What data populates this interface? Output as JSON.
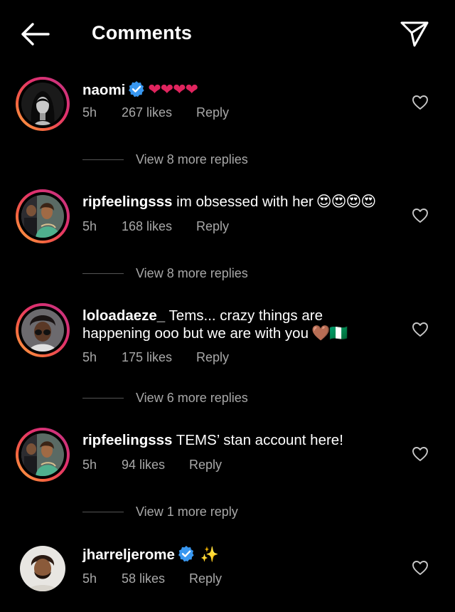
{
  "header": {
    "title": "Comments",
    "back_icon": "arrow-left-icon",
    "share_icon": "paper-plane-icon"
  },
  "colors": {
    "background": "#000000",
    "text": "#ffffff",
    "secondary": "#a8a8a8",
    "heart": "#e0245e",
    "verified": "#3897f0"
  },
  "comments": [
    {
      "username": "naomi",
      "verified": true,
      "text": "",
      "emoji": "❤❤❤❤",
      "time": "5h",
      "likes": "267 likes",
      "reply": "Reply"
    },
    {
      "username": "ripfeelingsss",
      "verified": false,
      "text": "im obsessed with her",
      "emoji": "😍😍😍😍",
      "time": "5h",
      "likes": "168 likes",
      "reply": "Reply"
    },
    {
      "username": "loloadaeze_",
      "verified": false,
      "text": "Tems... crazy things are",
      "text2": "happening ooo but we are with you",
      "emoji": "🤎🇳🇬",
      "time": "5h",
      "likes": "175 likes",
      "reply": "Reply"
    },
    {
      "username": "ripfeelingsss",
      "verified": false,
      "text": "TEMS’ stan account here!",
      "emoji": "",
      "time": "5h",
      "likes": "94 likes",
      "reply": "Reply"
    },
    {
      "username": "jharreljerome",
      "verified": true,
      "text": "",
      "emoji": "✨",
      "time": "5h",
      "likes": "58 likes",
      "reply": "Reply"
    }
  ],
  "view_more": [
    "View 8 more replies",
    "View 8 more replies",
    "View 6 more replies",
    "View 1 more reply"
  ]
}
